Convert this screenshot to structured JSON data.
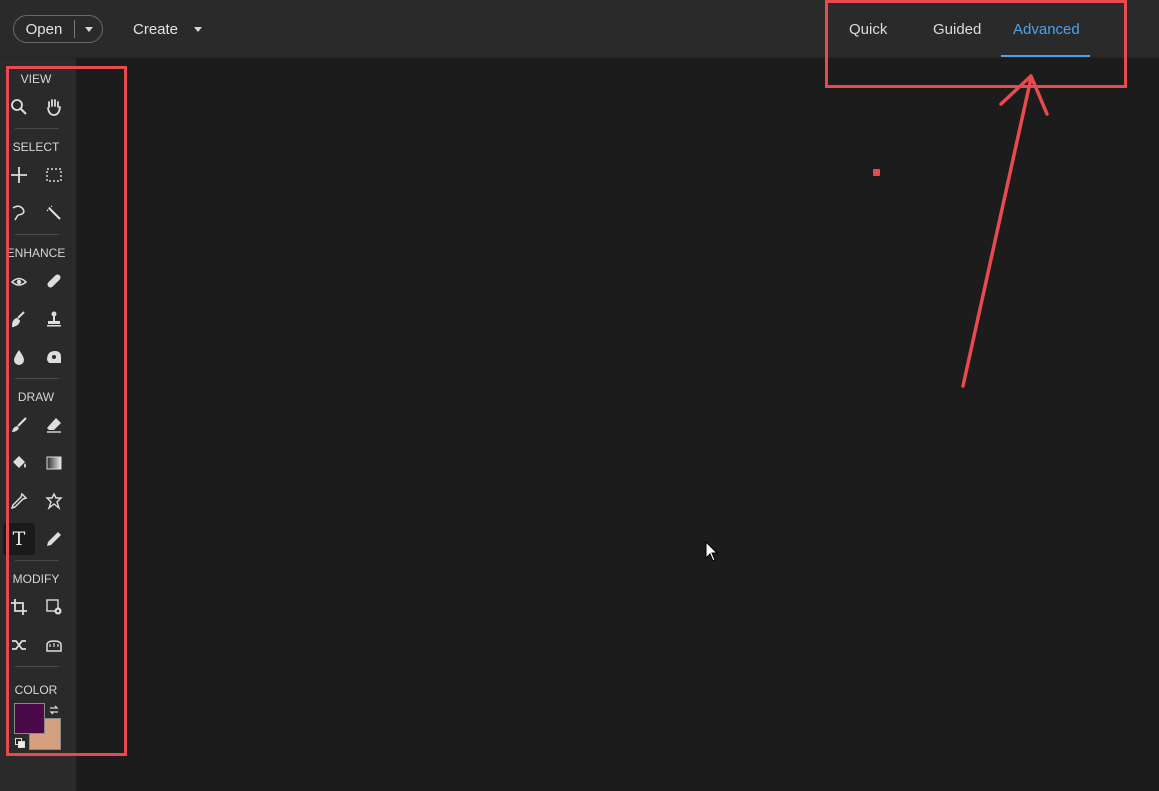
{
  "header": {
    "open_label": "Open",
    "create_label": "Create",
    "tabs": [
      {
        "label": "Quick",
        "active": false
      },
      {
        "label": "Guided",
        "active": false
      },
      {
        "label": "Advanced",
        "active": true
      }
    ],
    "accent_color": "#4aa3f0"
  },
  "toolbar": {
    "sections": {
      "view": "VIEW",
      "select": "SELECT",
      "enhance": "ENHANCE",
      "draw": "DRAW",
      "modify": "MODIFY",
      "color": "COLOR"
    },
    "type_tool_glyph": "T",
    "tools": [
      "zoom-tool",
      "hand-tool",
      "move-tool",
      "marquee-tool",
      "lasso-tool",
      "quick-selection-tool",
      "red-eye-tool",
      "spot-healing-tool",
      "smart-brush-tool",
      "clone-stamp-tool",
      "blur-tool",
      "sponge-tool",
      "brush-tool",
      "eraser-tool",
      "paint-bucket-tool",
      "gradient-tool",
      "eyedropper-tool",
      "custom-shape-tool",
      "type-tool",
      "pencil-tool",
      "crop-tool",
      "recompose-tool",
      "content-aware-move-tool",
      "straighten-tool"
    ],
    "foreground_color": "#4a0a4a",
    "background_color": "#d4a080"
  },
  "annotation_color": "#e84a4f"
}
